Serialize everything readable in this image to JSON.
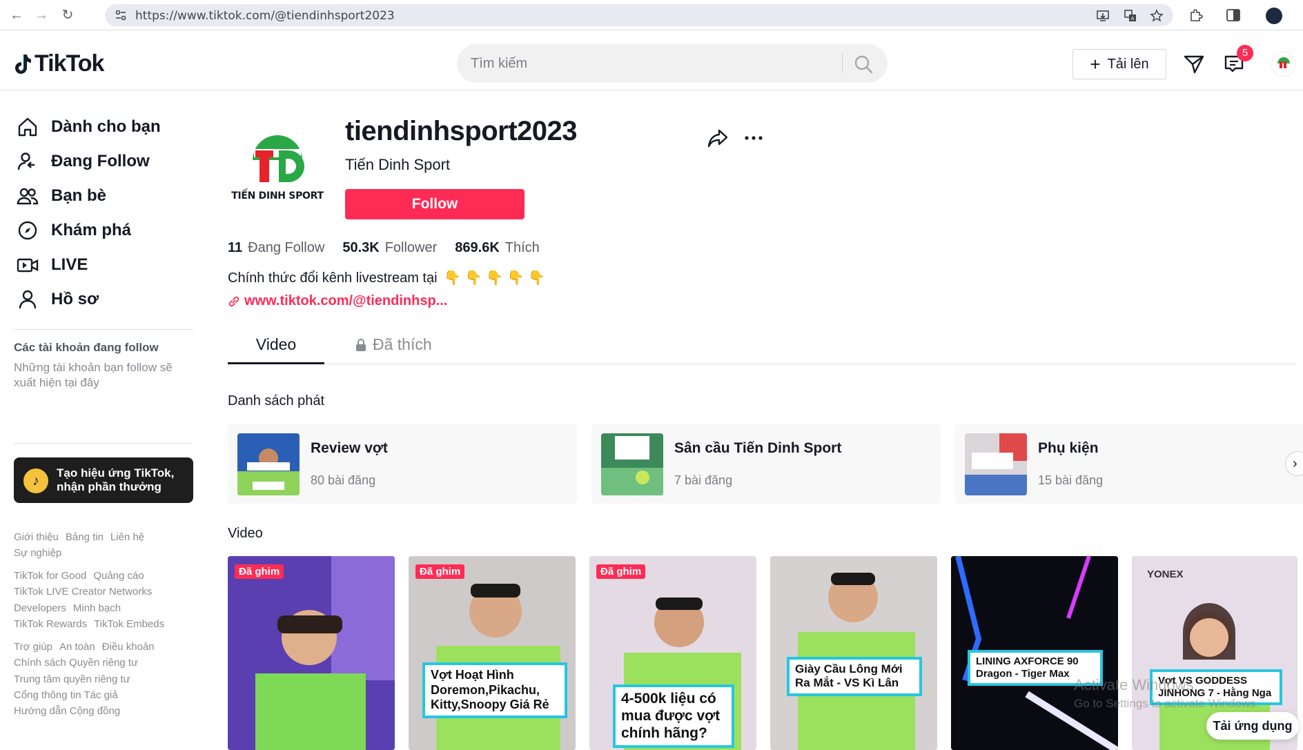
{
  "browser": {
    "url": "https://www.tiktok.com/@tiendinhsport2023"
  },
  "header": {
    "logo_text": "TikTok",
    "search_placeholder": "Tìm kiếm",
    "upload_label": "Tải lên",
    "inbox_badge": "5"
  },
  "sidebar": {
    "nav": [
      {
        "label": "Dành cho bạn",
        "icon": "home-icon"
      },
      {
        "label": "Đang Follow",
        "icon": "following-icon"
      },
      {
        "label": "Bạn bè",
        "icon": "friends-icon"
      },
      {
        "label": "Khám phá",
        "icon": "explore-icon"
      },
      {
        "label": "LIVE",
        "icon": "live-icon"
      },
      {
        "label": "Hồ sơ",
        "icon": "profile-icon"
      }
    ],
    "following_title": "Các tài khoản đang follow",
    "following_empty": "Những tài khoản bạn follow sẽ xuất hiện tại đây",
    "effect_banner": "Tạo hiệu ứng TikTok, nhận phần thưởng",
    "footer": [
      [
        "Giới thiệu",
        "Bảng tin",
        "Liên hệ"
      ],
      [
        "Sự nghiệp"
      ],
      [
        "TikTok for Good",
        "Quảng cáo"
      ],
      [
        "TikTok LIVE Creator Networks"
      ],
      [
        "Developers",
        "Minh bạch"
      ],
      [
        "TikTok Rewards",
        "TikTok Embeds"
      ],
      [
        "Trợ giúp",
        "An toàn",
        "Điều khoản"
      ],
      [
        "Chính sách Quyền riêng tư"
      ],
      [
        "Trung tâm quyền riêng tư"
      ],
      [
        "Cổng thông tin Tác giả"
      ],
      [
        "Hướng dẫn Cộng đồng"
      ]
    ]
  },
  "profile": {
    "username": "tiendinhsport2023",
    "nickname": "Tiến Dinh Sport",
    "avatar_text": "TIẾN DINH SPORT",
    "follow_label": "Follow",
    "stats": [
      {
        "num": "11",
        "label": "Đang Follow"
      },
      {
        "num": "50.3K",
        "label": "Follower"
      },
      {
        "num": "869.6K",
        "label": "Thích"
      }
    ],
    "bio": "Chính thức đổi kênh livestream tại",
    "bio_emoji": "👇 👇 👇 👇 👇",
    "link": "www.tiktok.com/@tiendinhsp..."
  },
  "tabs": {
    "video": "Video",
    "liked": "Đã thích"
  },
  "playlists": {
    "title": "Danh sách phát",
    "items": [
      {
        "name": "Review vợt",
        "count": "80 bài đăng"
      },
      {
        "name": "Sân cầu Tiến Dinh Sport",
        "count": "7 bài đăng"
      },
      {
        "name": "Phụ kiện",
        "count": "15 bài đăng"
      }
    ]
  },
  "videos": {
    "title": "Video",
    "pinned_label": "Đã ghim",
    "items": [
      {
        "caption": "",
        "pinned": true
      },
      {
        "caption": "Vợt Hoạt Hình Doremon,Pikachu, Kitty,Snoopy Giá Rẻ",
        "pinned": true
      },
      {
        "caption": "4-500k liệu có mua được vợt chính hãng?",
        "pinned": true
      },
      {
        "caption": "Giày Cầu Lông Mới Ra Mắt - VS Kì Lân",
        "pinned": false
      },
      {
        "caption": "LINING AXFORCE 90 Dragon - Tiger Max",
        "pinned": false
      },
      {
        "caption": "Vợt VS GODDESS JINHONG 7 - Hằng Nga",
        "pinned": false
      }
    ],
    "yonex_text": "YONEX"
  },
  "overlay": {
    "activate_title": "Activate Windows",
    "activate_sub": "Go to Settings to activate Windows.",
    "get_app": "Tải ứng dụng"
  },
  "colors": {
    "brand": "#fe2c55",
    "accent_cyan": "#25c7de",
    "jersey_green": "#9be15d"
  }
}
